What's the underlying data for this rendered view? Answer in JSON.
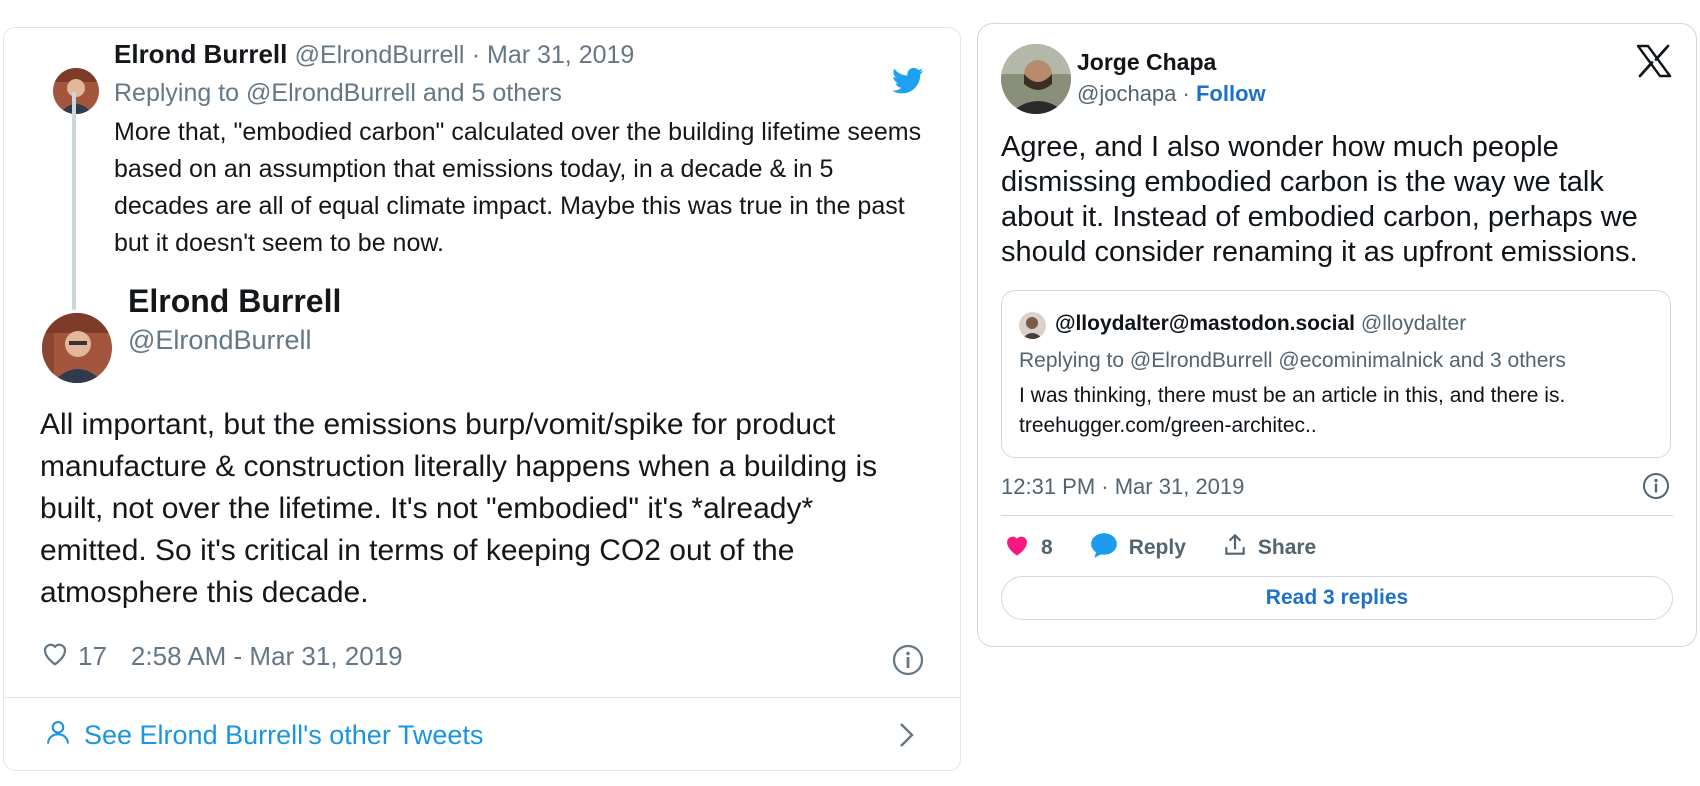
{
  "embed1": {
    "reply": {
      "author_name": "Elrond Burrell",
      "author_handle": "@ElrondBurrell",
      "date": "· Mar 31, 2019",
      "replying_to": "Replying to @ElrondBurrell and 5 others",
      "text": "More that, \"embodied carbon\" calculated over the building lifetime seems based on an assumption that emissions today, in a decade & in 5 decades are all of equal climate impact. Maybe this was true in the past but it doesn't seem to be now."
    },
    "main": {
      "author_name": "Elrond Burrell",
      "author_handle": "@ElrondBurrell",
      "text": "All important, but the emissions burp/vomit/spike for product manufacture & construction literally happens when a building is built, not over the lifetime. It's not \"embodied\" it's *already* emitted. So it's critical in terms of keeping CO2 out of the atmosphere this decade.",
      "likes": "17",
      "timestamp": "2:58 AM - Mar 31, 2019"
    },
    "footer_link": "See Elrond Burrell's other Tweets",
    "brand_color": "#1da1f2"
  },
  "embed2": {
    "author_name": "Jorge Chapa",
    "author_handle": "@jochapa",
    "separator": "·",
    "follow_label": "Follow",
    "text": "Agree, and I also wonder how much people dismissing embodied carbon is the way we talk about it. Instead of embodied carbon, perhaps we should consider renaming it as upfront emissions.",
    "quote": {
      "author_name": "@lloydalter@mastodon.social",
      "author_handle": "@lloydalter",
      "replying_to": "Replying to @ElrondBurrell @ecominimalnick and 3 others",
      "text": "I was thinking, there must be an article in this, and there is.",
      "link": "treehugger.com/green-architec.."
    },
    "timestamp": "12:31 PM · Mar 31, 2019",
    "likes": "8",
    "reply_label": "Reply",
    "share_label": "Share",
    "read_replies_label": "Read 3 replies",
    "accent_color": "#1d72c8",
    "heart_color": "#f91880"
  }
}
